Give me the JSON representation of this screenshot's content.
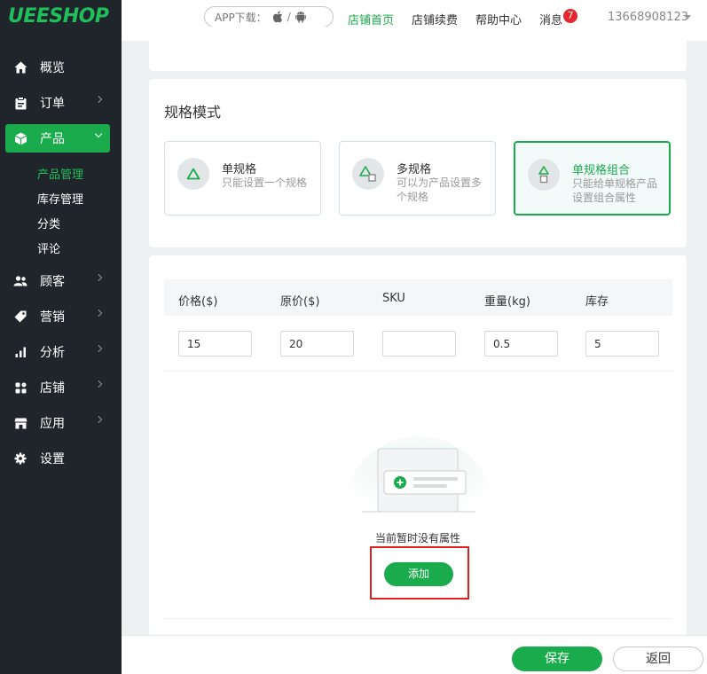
{
  "brand": {
    "logo": "UEESHOP",
    "accent": "#1aac4c"
  },
  "sidebar": {
    "items": [
      {
        "label": "概览",
        "icon": "home-icon"
      },
      {
        "label": "订单",
        "icon": "clipboard-icon"
      },
      {
        "label": "产品",
        "icon": "box-icon",
        "active": true
      },
      {
        "label": "顾客",
        "icon": "users-icon"
      },
      {
        "label": "营销",
        "icon": "tag-icon"
      },
      {
        "label": "分析",
        "icon": "bar-chart-icon"
      },
      {
        "label": "店铺",
        "icon": "grid-icon"
      },
      {
        "label": "应用",
        "icon": "store-icon"
      },
      {
        "label": "设置",
        "icon": "gear-icon"
      }
    ],
    "product_sub": [
      "产品管理",
      "库存管理",
      "分类",
      "评论"
    ]
  },
  "topbar": {
    "app_download": "APP下载：",
    "app_sep": "/",
    "nav": [
      "店铺首页",
      "店铺续费",
      "帮助中心",
      "消息"
    ],
    "message_count": "7",
    "user": "13668908123"
  },
  "spec_mode": {
    "title": "规格模式",
    "options": [
      {
        "title": "单规格",
        "desc": "只能设置一个规格"
      },
      {
        "title": "多规格",
        "desc": "可以为产品设置多个规格"
      },
      {
        "title": "单规格组合",
        "desc": "只能给单规格产品设置组合属性",
        "selected": true
      }
    ]
  },
  "table": {
    "headers": [
      "价格($)",
      "原价($)",
      "SKU",
      "重量(kg)",
      "库存"
    ],
    "values": [
      "15",
      "20",
      "",
      "0.5",
      "5"
    ]
  },
  "empty": {
    "text": "当前暂时没有属性",
    "add_label": "添加"
  },
  "footer": {
    "save_label": "保存",
    "back_label": "返回"
  }
}
